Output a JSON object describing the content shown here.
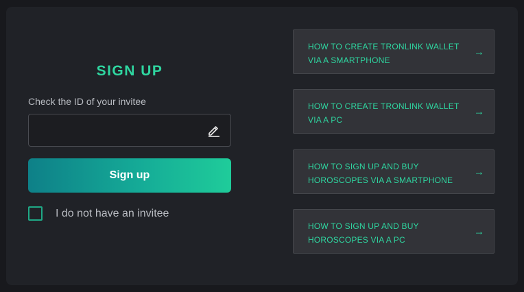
{
  "signup": {
    "title": "SIGN UP",
    "field_label": "Check the ID of your invitee",
    "input_value": "",
    "button_label": "Sign up",
    "checkbox_label": "I do not have an invitee",
    "checkbox_checked": false
  },
  "guides": [
    {
      "label": "HOW TO CREATE TRONLINK WALLET VIA A SMARTPHONE",
      "arrow": "→"
    },
    {
      "label": "HOW TO CREATE TRONLINK WALLET VIA A PC",
      "arrow": "→"
    },
    {
      "label": "HOW TO SIGN UP AND BUY HOROSCOPES VIA A SMARTPHONE",
      "arrow": "→"
    },
    {
      "label": "HOW TO SIGN UP AND BUY HOROSCOPES VIA A PC",
      "arrow": "→"
    }
  ],
  "icons": {
    "edit": "pencil-edit-icon",
    "arrow": "arrow-right-icon"
  },
  "colors": {
    "accent": "#2fd6a0",
    "button_gradient_start": "#0e8088",
    "button_gradient_end": "#1fcc9a",
    "panel_bg": "#202227",
    "card_bg": "#323338"
  }
}
